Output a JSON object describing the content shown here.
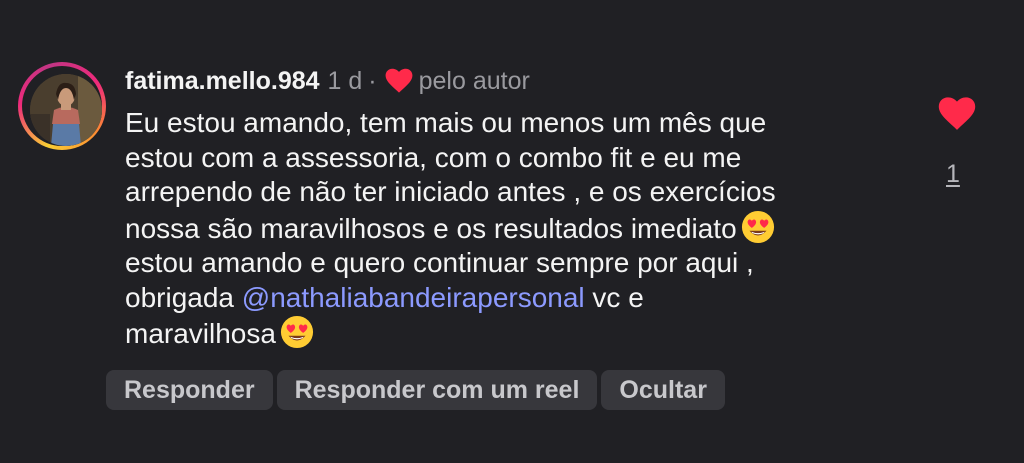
{
  "comment": {
    "username": "fatima.mello.984",
    "time": "1 d",
    "separator": "·",
    "liked_by_author_label": "pelo autor",
    "body": {
      "line1": "Eu estou amando, tem mais ou menos um mês que",
      "line2": "estou com a assessoria, com o combo fit e eu me",
      "line3": "arrependo de não ter iniciado antes , e os exercícios",
      "line4": "nossa são maravilhosos e os resultados imediato",
      "line5": "estou amando e quero continuar sempre por aqui ,",
      "line6_prefix": "obrigada ",
      "mention": "@nathaliabandeirapersonal",
      "line6_suffix": " vc e",
      "line7": "maravilhosa"
    },
    "emoji_icon": "heart-eyes-emoji-icon",
    "like_icon": "heart-icon",
    "like_count": "1",
    "actions": {
      "reply": "Responder",
      "reply_reel": "Responder com um reel",
      "hide": "Ocultar"
    }
  },
  "colors": {
    "background": "#202024",
    "heart": "#ff2a4a",
    "mention": "#8c9aff",
    "button_bg": "#37373c"
  }
}
